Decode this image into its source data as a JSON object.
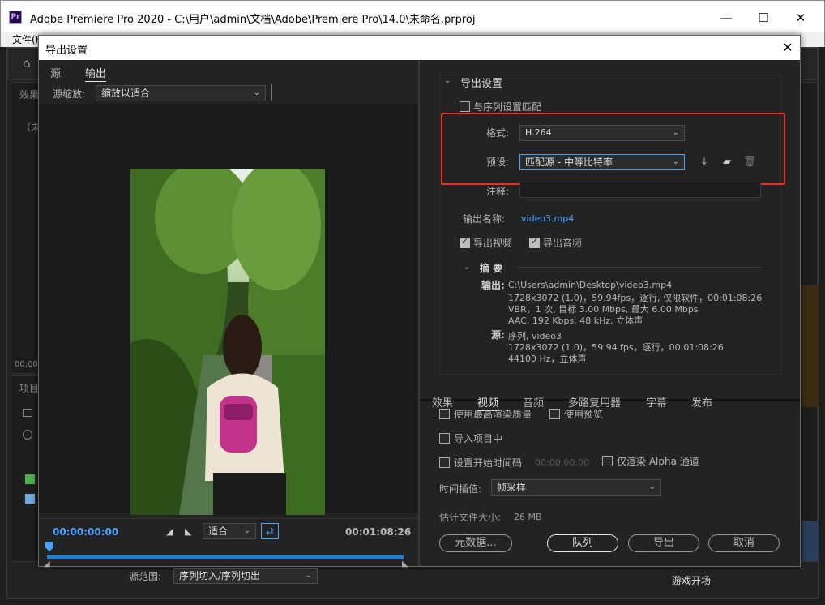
{
  "window": {
    "title": "Adobe Premiere Pro 2020 - C:\\用户\\admin\\文档\\Adobe\\Premiere Pro\\14.0\\未命名.prproj",
    "logo": "Pr",
    "minimize": "—",
    "maximize": "☐",
    "close": "✕"
  },
  "menubar": {
    "file": "文件(F)"
  },
  "background": {
    "effects_label": "效果",
    "unnamed_label": "（未",
    "timecode_label": "00:00:",
    "project_label": "项目",
    "bottom_right_text": "游戏开场"
  },
  "dialog": {
    "title": "导出设置",
    "close": "✕"
  },
  "left": {
    "tabs": [
      "源",
      "输出"
    ],
    "scale_label": "源缩放:",
    "scale_value": "缩放以适合",
    "timecode_start": "00:00:00:00",
    "fit_value": "适合",
    "timecode_end": "00:01:08:26",
    "range_label": "源范围:",
    "range_value": "序列切入/序列切出"
  },
  "right": {
    "section_title": "导出设置",
    "match_sequence_label": "与序列设置匹配",
    "format_label": "格式:",
    "format_value": "H.264",
    "preset_label": "预设:",
    "preset_value": "匹配源 - 中等比特率",
    "comments_label": "注释:",
    "output_name_label": "输出名称:",
    "output_name_value": "video3.mp4",
    "export_video_label": "导出视频",
    "export_audio_label": "导出音频",
    "summary_title": "摘 要",
    "summary_output_label": "输出:",
    "summary_output_lines": [
      "C:\\Users\\admin\\Desktop\\video3.mp4",
      "1728x3072 (1.0)，59.94fps，逐行, 仅限软件，00:01:08:26",
      "VBR，1 次, 目标 3.00 Mbps, 最大 6.00 Mbps",
      "AAC, 192 Kbps, 48 kHz, 立体声"
    ],
    "summary_source_label": "源:",
    "summary_source_lines": [
      "序列, video3",
      "1728x3072 (1.0)，59.94 fps，逐行，00:01:08:26",
      "44100 Hz，立体声"
    ],
    "tabs": [
      "效果",
      "视频",
      "音频",
      "多路复用器",
      "字幕",
      "发布"
    ],
    "max_render_label": "使用最高渲染质量",
    "use_previews_label": "使用预览",
    "import_project_label": "导入项目中",
    "start_timecode_label": "设置开始时间码",
    "start_timecode_value": "00:00:00:00",
    "alpha_only_label": "仅渲染 Alpha 通道",
    "time_interp_label": "时间插值:",
    "time_interp_value": "帧采样",
    "est_size_label": "估计文件大小:",
    "est_size_value": "26 MB",
    "metadata_button": "元数据...",
    "queue_button": "队列",
    "export_button": "导出",
    "cancel_button": "取消"
  },
  "colors": {
    "highlight_box": "#e8302a",
    "timecode_blue": "#4aa3ff",
    "scrub_bar": "#1f7fd1"
  }
}
